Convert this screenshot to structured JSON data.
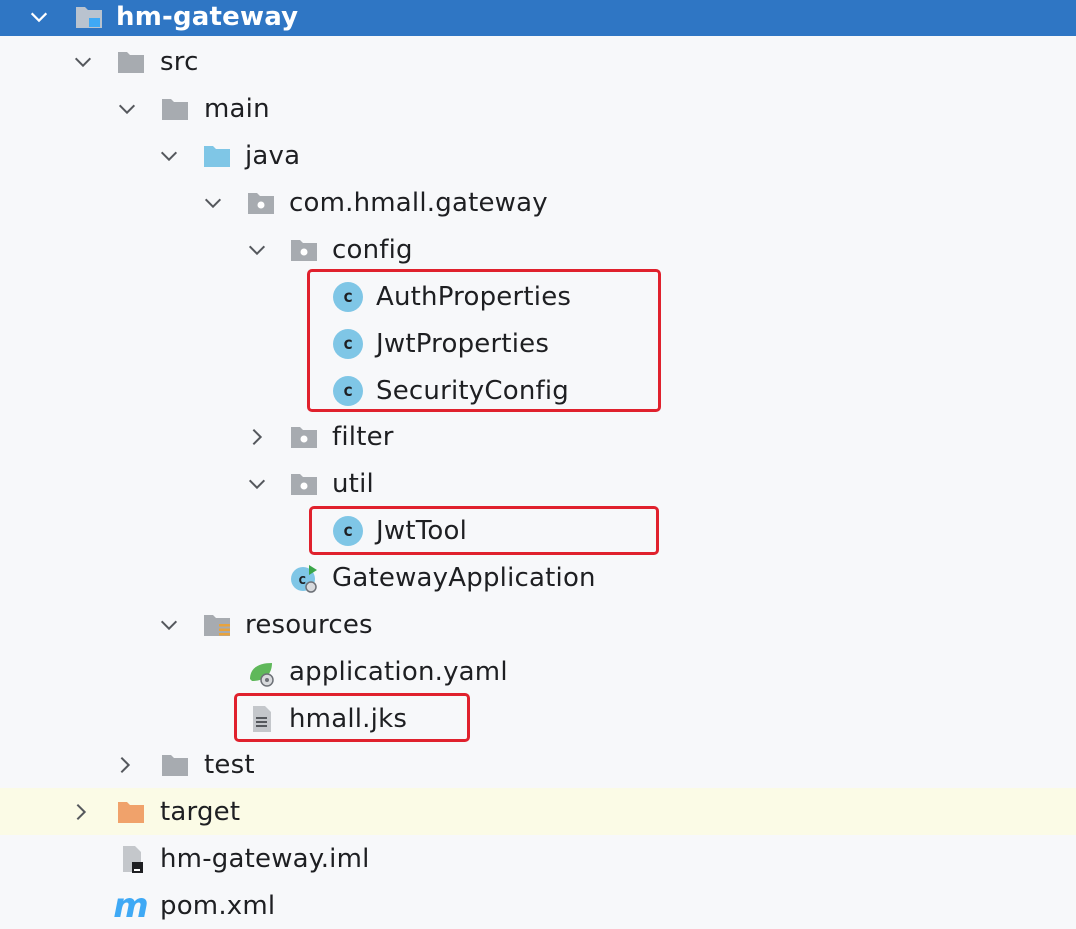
{
  "tree": {
    "root": "hm-gateway",
    "src": "src",
    "main": "main",
    "java": "java",
    "package": "com.hmall.gateway",
    "config": "config",
    "auth_properties": "AuthProperties",
    "jwt_properties": "JwtProperties",
    "security_config": "SecurityConfig",
    "filter": "filter",
    "util": "util",
    "jwt_tool": "JwtTool",
    "gateway_application": "GatewayApplication",
    "resources": "resources",
    "application_yaml": "application.yaml",
    "hmall_jks": "hmall.jks",
    "test": "test",
    "target": "target",
    "iml": "hm-gateway.iml",
    "pom": "pom.xml",
    "class_badge": "c",
    "maven_badge": "m"
  },
  "colors": {
    "selection": "#2f76c4",
    "folder_gray": "#a7abb0",
    "source_folder": "#7fc6e6",
    "excluded_folder": "#f0a26b",
    "class_icon": "#7fc6e6",
    "highlight_box": "#e0212d",
    "target_row": "#fbfbe6"
  },
  "icons": {
    "expanded": "chevron-down-icon",
    "collapsed": "chevron-right-icon",
    "module": "module-folder-icon",
    "folder": "folder-icon",
    "source_root": "source-root-folder-icon",
    "package": "package-icon",
    "class": "class-icon",
    "spring_boot_app": "spring-boot-app-icon",
    "resources_root": "resources-root-folder-icon",
    "yaml": "spring-yaml-icon",
    "file": "text-file-icon",
    "excluded": "excluded-folder-icon",
    "iml": "iml-file-icon",
    "maven": "maven-icon"
  }
}
